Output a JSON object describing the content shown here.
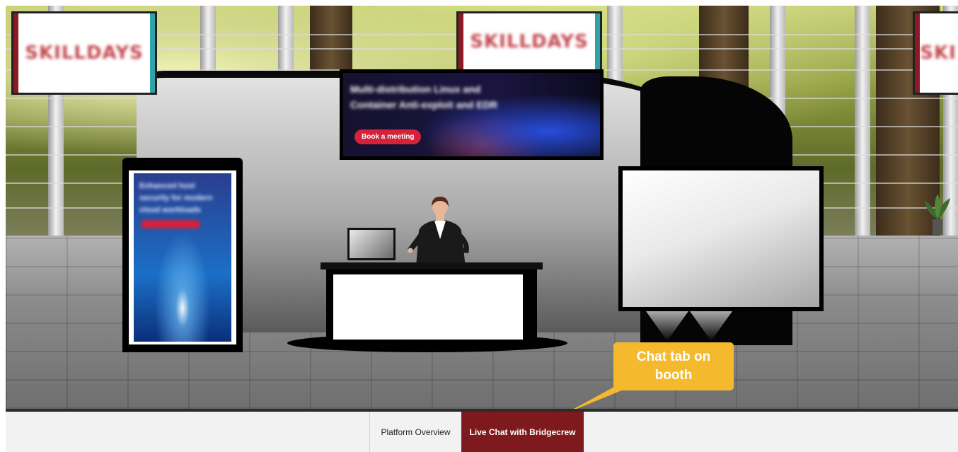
{
  "booth": {
    "top_banners": [
      {
        "logo_text": "SKILLDAYS"
      },
      {
        "logo_text": "SKILLDAYS"
      },
      {
        "logo_text": "SKI"
      }
    ],
    "header_screen": {
      "headline": "Multi-distribution Linux and Container Anti-exploit and EDR",
      "button_label": "Book a meeting"
    },
    "totem_screen": {
      "blurred_text": "Enhanced host security for modern cloud workloads"
    }
  },
  "annotation": {
    "callout_text": "Chat tab on booth"
  },
  "tabs": [
    {
      "label": "Platform Overview",
      "active": false
    },
    {
      "label": "Live Chat with Bridgecrew",
      "active": true
    }
  ],
  "colors": {
    "active_tab": "#7e1a1d",
    "callout": "#f5b92e",
    "cta_button": "#d3223a"
  },
  "icons": [
    "presenter-avatar",
    "plant-icon"
  ]
}
